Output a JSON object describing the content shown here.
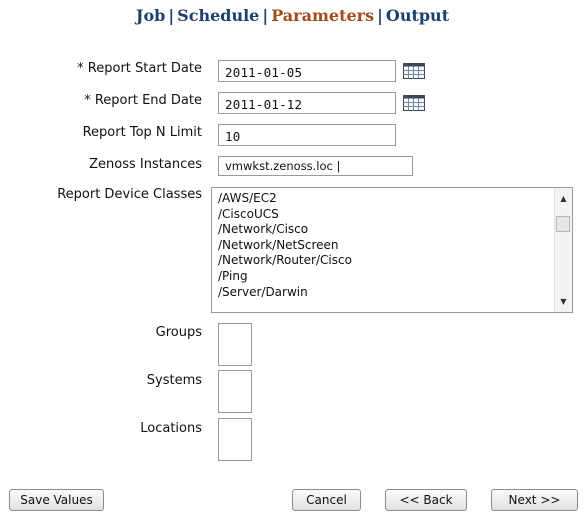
{
  "nav": {
    "tabs": [
      {
        "label": "Job"
      },
      {
        "label": "Schedule"
      },
      {
        "label": "Parameters"
      },
      {
        "label": "Output"
      }
    ],
    "separator": "|",
    "active_color": "#a14a1a",
    "link_color": "#1d3f6e"
  },
  "form": {
    "start_date": {
      "label": "* Report Start Date",
      "value": "2011-01-05",
      "icon": "calendar-icon"
    },
    "end_date": {
      "label": "* Report End Date",
      "value": "2011-01-12",
      "icon": "calendar-icon"
    },
    "top_n": {
      "label": "Report Top N Limit",
      "value": "10"
    },
    "zenoss_instances": {
      "label": "Zenoss Instances",
      "value": "vmwkst.zenoss.loc |"
    },
    "device_classes": {
      "label": "Report Device Classes",
      "options": [
        "/AWS/EC2",
        "/CiscoUCS",
        "/Network/Cisco",
        "/Network/NetScreen",
        "/Network/Router/Cisco",
        "/Ping",
        "/Server/Darwin"
      ]
    },
    "groups": {
      "label": "Groups"
    },
    "systems": {
      "label": "Systems"
    },
    "locations": {
      "label": "Locations"
    }
  },
  "buttons": {
    "save": "Save Values",
    "cancel": "Cancel",
    "back": "<< Back",
    "next": "Next >>"
  }
}
